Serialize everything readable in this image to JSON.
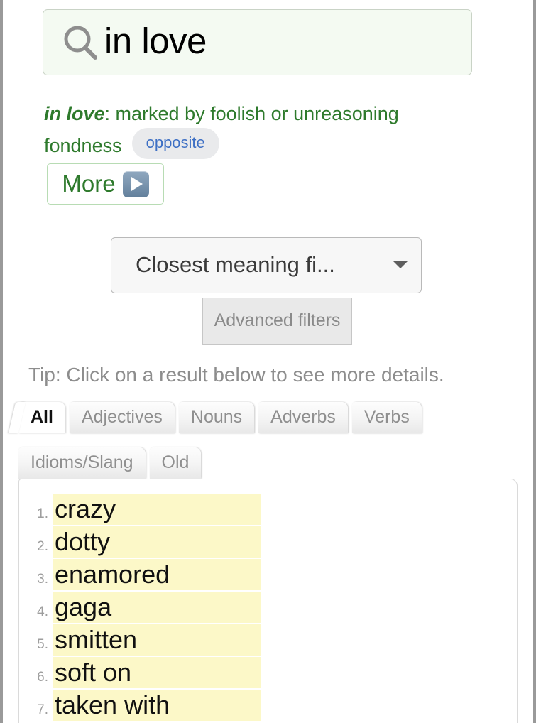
{
  "search": {
    "icon": "search-icon",
    "value": "in love"
  },
  "definition": {
    "headword": "in love",
    "separator": ": ",
    "text": "marked by foolish or unreasoning fondness",
    "badge": "opposite",
    "badge_color": "#3d6fc4",
    "text_color": "#2e7a2c"
  },
  "more_button": {
    "label": "More",
    "icon": "play-icon"
  },
  "filter_select": {
    "value": "Closest meaning fi...",
    "icon": "chevron-down-icon"
  },
  "advanced_filters": {
    "label": "Advanced filters"
  },
  "tip": {
    "text": "Tip: Click on a result below to see more details."
  },
  "tabs": {
    "row1": [
      {
        "label": "All",
        "active": true
      },
      {
        "label": "Adjectives",
        "active": false
      },
      {
        "label": "Nouns",
        "active": false
      },
      {
        "label": "Adverbs",
        "active": false
      },
      {
        "label": "Verbs",
        "active": false
      }
    ],
    "row2": [
      {
        "label": "Idioms/Slang",
        "active": false
      },
      {
        "label": "Old",
        "active": false
      }
    ]
  },
  "results": {
    "highlight_color": "#fcf8c8",
    "items": [
      {
        "num": "1.",
        "word": "crazy"
      },
      {
        "num": "2.",
        "word": "dotty"
      },
      {
        "num": "3.",
        "word": "enamored"
      },
      {
        "num": "4.",
        "word": "gaga"
      },
      {
        "num": "5.",
        "word": "smitten"
      },
      {
        "num": "6.",
        "word": "soft on"
      },
      {
        "num": "7.",
        "word": "taken with"
      }
    ]
  }
}
